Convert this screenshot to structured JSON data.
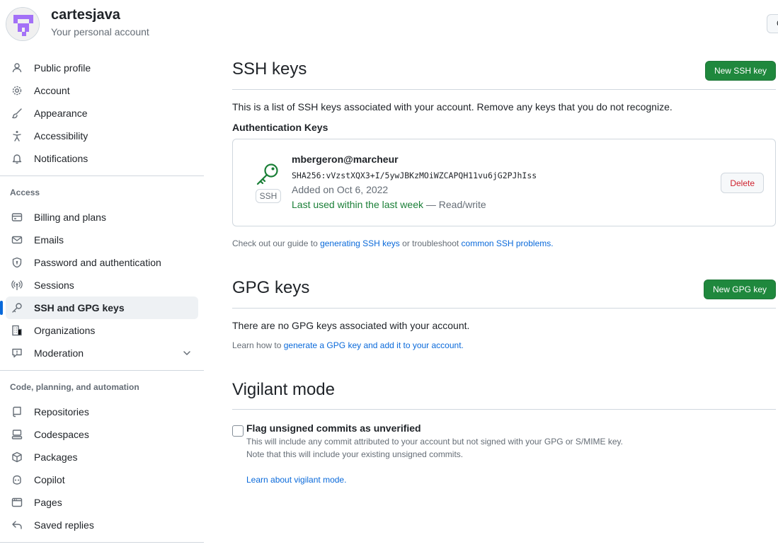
{
  "header": {
    "account_name": "cartesjava",
    "account_sub": "Your personal account",
    "top_right_button": "G"
  },
  "sidebar": {
    "items_top": [
      {
        "label": "Public profile",
        "icon": "person-icon"
      },
      {
        "label": "Account",
        "icon": "gear-icon"
      },
      {
        "label": "Appearance",
        "icon": "paintbrush-icon"
      },
      {
        "label": "Accessibility",
        "icon": "accessibility-icon"
      },
      {
        "label": "Notifications",
        "icon": "bell-icon"
      }
    ],
    "access_heading": "Access",
    "items_access": [
      {
        "label": "Billing and plans",
        "icon": "credit-card-icon"
      },
      {
        "label": "Emails",
        "icon": "mail-icon"
      },
      {
        "label": "Password and authentication",
        "icon": "shield-lock-icon"
      },
      {
        "label": "Sessions",
        "icon": "broadcast-icon"
      },
      {
        "label": "SSH and GPG keys",
        "icon": "key-icon",
        "active": true
      },
      {
        "label": "Organizations",
        "icon": "organization-icon"
      },
      {
        "label": "Moderation",
        "icon": "report-icon"
      }
    ],
    "code_heading": "Code, planning, and automation",
    "items_code": [
      {
        "label": "Repositories",
        "icon": "repo-icon"
      },
      {
        "label": "Codespaces",
        "icon": "codespaces-icon"
      },
      {
        "label": "Packages",
        "icon": "package-icon"
      },
      {
        "label": "Copilot",
        "icon": "copilot-icon"
      },
      {
        "label": "Pages",
        "icon": "browser-icon"
      },
      {
        "label": "Saved replies",
        "icon": "reply-icon"
      }
    ]
  },
  "ssh": {
    "title": "SSH keys",
    "new_button": "New SSH key",
    "description": "This is a list of SSH keys associated with your account. Remove any keys that you do not recognize.",
    "auth_heading": "Authentication Keys",
    "key": {
      "badge": "SSH",
      "title": "mbergeron@marcheur",
      "fingerprint": "SHA256:vVzstXQX3+I/5ywJBKzMOiWZCAPQH11vu6jG2PJhIss",
      "added": "Added on Oct 6, 2022",
      "last_used": "Last used within the last week",
      "access": " — Read/write",
      "delete_button": "Delete"
    },
    "guide_prefix": "Check out our guide to ",
    "guide_link1": "generating SSH keys",
    "guide_middle": " or troubleshoot ",
    "guide_link2": "common SSH problems."
  },
  "gpg": {
    "title": "GPG keys",
    "new_button": "New GPG key",
    "empty_text": "There are no GPG keys associated with your account.",
    "learn_prefix": "Learn how to ",
    "learn_link": "generate a GPG key and add it to your account."
  },
  "vigilant": {
    "title": "Vigilant mode",
    "checkbox_label": "Flag unsigned commits as unverified",
    "checked": false,
    "note1": "This will include any commit attributed to your account but not signed with your GPG or S/MIME key.",
    "note2": "Note that this will include your existing unsigned commits.",
    "learn_link": "Learn about vigilant mode."
  },
  "colors": {
    "accent": "#0969da",
    "green_button": "#1f883d",
    "danger": "#cf222e",
    "success_text": "#1a7f37",
    "border": "#d0d7de",
    "avatar": "#a371f7"
  }
}
